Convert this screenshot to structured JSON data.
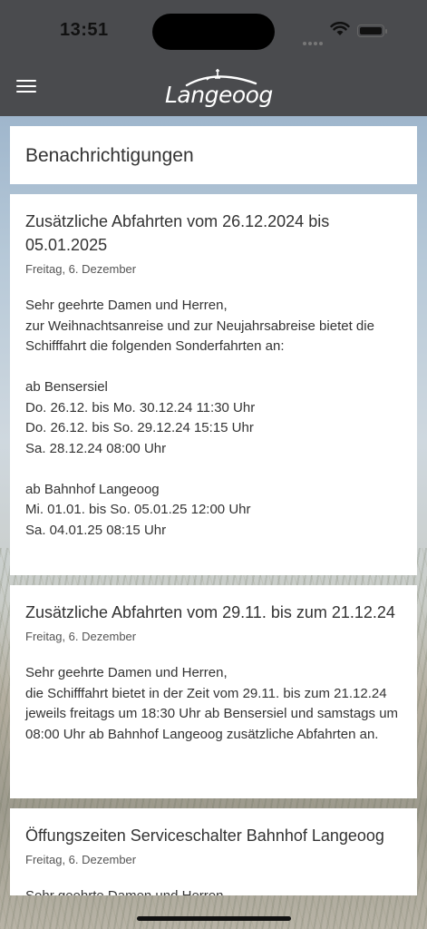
{
  "status_bar": {
    "time": "13:51"
  },
  "app_bar": {
    "logo_text": "Langeoog"
  },
  "page": {
    "title": "Benachrichtigungen"
  },
  "notifications": [
    {
      "title": "Zusätzliche Abfahrten vom 26.12.2024 bis 05.01.2025",
      "date": "Freitag, 6. Dezember",
      "body": "Sehr geehrte Damen und Herren,\nzur Weihnachtsanreise und zur Neujahrsabreise bietet die Schifffahrt die folgenden Sonderfahrten an:\n\nab Bensersiel\nDo. 26.12. bis Mo. 30.12.24  11:30 Uhr\nDo. 26.12. bis So. 29.12.24  15:15 Uhr\nSa. 28.12.24 08:00 Uhr\n\nab Bahnhof Langeoog\nMi. 01.01. bis So. 05.01.25 12:00 Uhr\nSa. 04.01.25 08:15 Uhr"
    },
    {
      "title": "Zusätzliche Abfahrten vom 29.11. bis zum 21.12.24",
      "date": "Freitag, 6. Dezember",
      "body": "Sehr geehrte Damen und Herren,\ndie Schifffahrt bietet in der Zeit vom 29.11. bis zum 21.12.24 jeweils freitags um 18:30 Uhr ab Bensersiel und samstags um 08:00 Uhr ab Bahnhof Langeoog zusätzliche Abfahrten an."
    },
    {
      "title": "Öffungszeiten Serviceschalter Bahnhof Langeoog",
      "date": "Freitag, 6. Dezember",
      "body": "Sehr geehrte Damen und Herren,"
    }
  ]
}
